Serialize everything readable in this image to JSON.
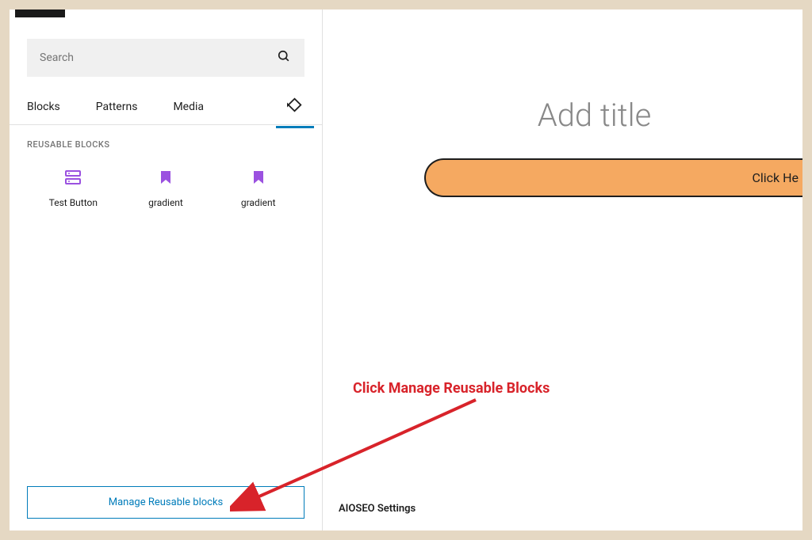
{
  "search": {
    "placeholder": "Search"
  },
  "tabs": {
    "blocks": "Blocks",
    "patterns": "Patterns",
    "media": "Media"
  },
  "section": {
    "title": "REUSABLE BLOCKS"
  },
  "blocks": [
    {
      "label": "Test Button"
    },
    {
      "label": "gradient"
    },
    {
      "label": "gradient"
    }
  ],
  "manageButton": "Manage Reusable blocks",
  "editor": {
    "titlePlaceholder": "Add title",
    "buttonText": "Click He"
  },
  "annotation": {
    "text": "Click Manage Reusable Blocks"
  },
  "footer": {
    "aioseo": "AIOSEO Settings"
  }
}
